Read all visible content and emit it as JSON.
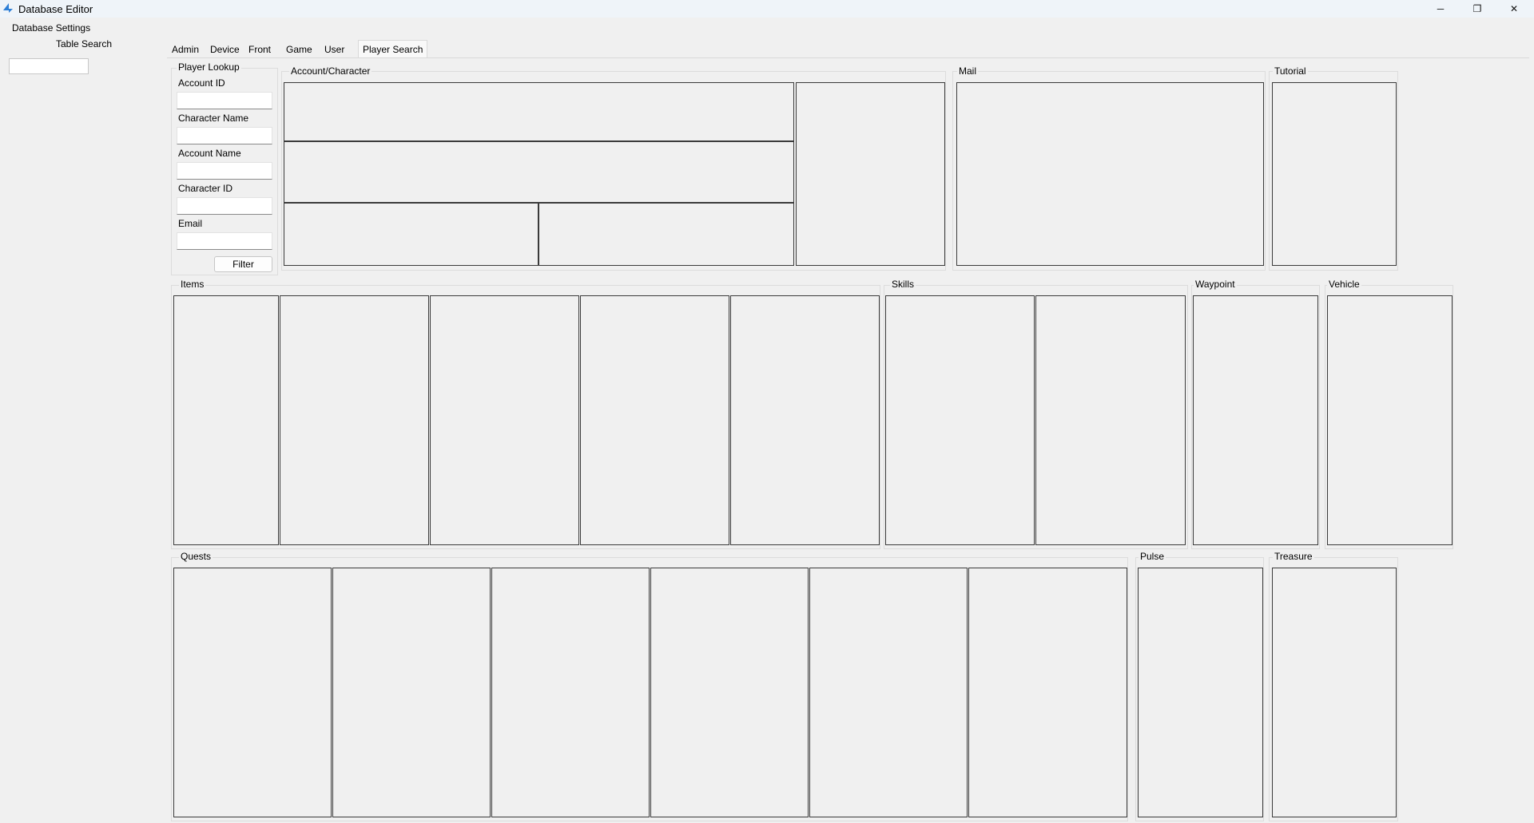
{
  "window": {
    "title": "Database Editor",
    "minimize_icon": "minimize-icon",
    "maximize_icon": "restore-icon",
    "close_icon": "close-icon",
    "min_glyph": "─",
    "max_glyph": "❐",
    "close_glyph": "✕"
  },
  "menu": {
    "database_settings": "Database Settings",
    "table_search": "Table Search",
    "search_value": ""
  },
  "tabs": [
    {
      "label": "Admin"
    },
    {
      "label": "Device"
    },
    {
      "label": "Front"
    },
    {
      "label": "Game"
    },
    {
      "label": "User"
    },
    {
      "label": "Player Search",
      "selected": true
    }
  ],
  "player_lookup": {
    "title": "Player Lookup",
    "fields": [
      {
        "label": "Account ID",
        "value": ""
      },
      {
        "label": "Character Name",
        "value": ""
      },
      {
        "label": "Account Name",
        "value": ""
      },
      {
        "label": "Character ID",
        "value": ""
      },
      {
        "label": "Email",
        "value": ""
      }
    ],
    "filter_label": "Filter"
  },
  "groups": {
    "account_character": "Account/Character",
    "mail": "Mail",
    "tutorial": "Tutorial",
    "items": "Items",
    "skills": "Skills",
    "waypoint": "Waypoint",
    "vehicle": "Vehicle",
    "quests": "Quests",
    "pulse": "Pulse",
    "treasure": "Treasure"
  },
  "colors": {
    "titlebar": "#eff4f9",
    "background": "#f0f0f0",
    "accent": "#2d7fd6"
  }
}
